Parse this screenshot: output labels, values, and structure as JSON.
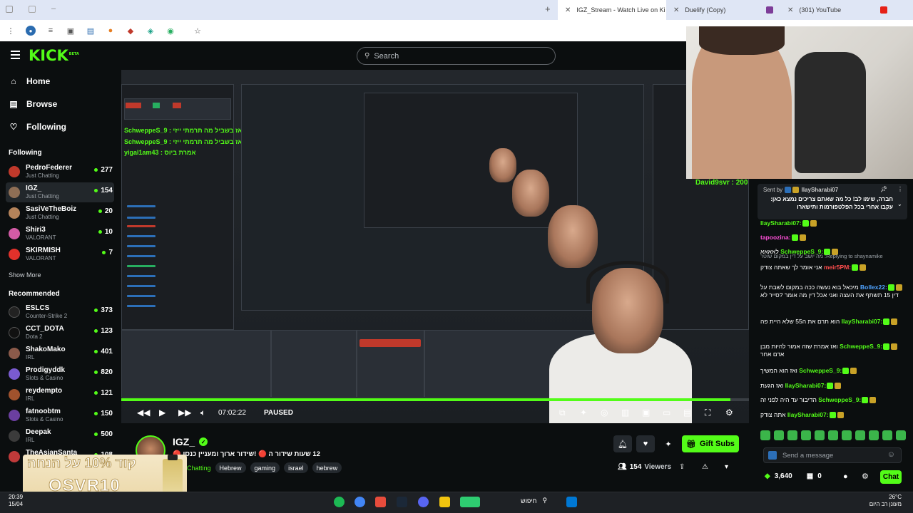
{
  "browser": {
    "tabs": [
      {
        "title": "IGZ_Stream - Watch Live on Ki",
        "active": true
      },
      {
        "title": "Duelify (Copy)",
        "active": false
      },
      {
        "title": "(301) YouTube",
        "active": false
      }
    ]
  },
  "header": {
    "logo": "KICK",
    "logo_sup": "BETA",
    "search_placeholder": "Search"
  },
  "sidebar": {
    "nav": [
      {
        "label": "Home",
        "icon": "home-icon"
      },
      {
        "label": "Browse",
        "icon": "browse-icon"
      },
      {
        "label": "Following",
        "icon": "heart-icon"
      }
    ],
    "following_title": "Following",
    "following": [
      {
        "name": "PedroFederer",
        "category": "Just Chatting",
        "viewers": "277",
        "color": "#c0392b"
      },
      {
        "name": "IGZ_",
        "category": "Just Chatting",
        "viewers": "154",
        "color": "#8e6e55",
        "selected": true
      },
      {
        "name": "SasiVeTheBoiz",
        "category": "Just Chatting",
        "viewers": "20",
        "color": "#b5835a"
      },
      {
        "name": "Shiri3",
        "category": "VALORANT",
        "viewers": "10",
        "color": "#d35ba6"
      },
      {
        "name": "SKIRMISH",
        "category": "VALORANT",
        "viewers": "7",
        "color": "#e0312b"
      }
    ],
    "show_more": "Show More",
    "recommended_title": "Recommended",
    "recommended": [
      {
        "name": "ESLCS",
        "category": "Counter-Strike 2",
        "viewers": "373",
        "color": "#222"
      },
      {
        "name": "CCT_DOTA",
        "category": "Dota 2",
        "viewers": "123",
        "color": "#111"
      },
      {
        "name": "ShakoMako",
        "category": "IRL",
        "viewers": "401",
        "color": "#8b5a4a"
      },
      {
        "name": "Prodigyddk",
        "category": "Slots & Casino",
        "viewers": "820",
        "color": "#7a5bd0"
      },
      {
        "name": "reydempto",
        "category": "IRL",
        "viewers": "121",
        "color": "#a0522d"
      },
      {
        "name": "fatnoobtm",
        "category": "Slots & Casino",
        "viewers": "150",
        "color": "#6b3fa0"
      },
      {
        "name": "Deepak",
        "category": "IRL",
        "viewers": "500",
        "color": "#3b3b3b"
      },
      {
        "name": "TheAsianSanta",
        "category": "",
        "viewers": "108",
        "color": "#c03a3a"
      }
    ]
  },
  "player": {
    "time": "07:02:22",
    "status": "PAUSED",
    "progress": 0.97
  },
  "stream": {
    "owner": "IGZ_",
    "title": "12 שעות שידור ה 🔴 !שידור ארוך ומעניין כנסו 🔴",
    "category": "Chatting",
    "tags": [
      "Hebrew",
      "gaming",
      "israel",
      "hebrew"
    ],
    "viewers": "154",
    "viewers_label": "Viewers",
    "gift_button": "Gift Subs"
  },
  "overlay": {
    "viewer_top": "David9svr : 200",
    "promo_line1": "קוד 10% על הנחה",
    "promo_code": "OSVR10"
  },
  "chat": {
    "pinned_header": "Sent by",
    "pinned_user": "IlaySharabi07",
    "pinned_text": "חברה, שימו לב! כל מה שאתם צריכים נמצא כאן: עקבו אחרי בכל הפלטפורמות ותישארו",
    "messages": [
      {
        "user": "IlaySharabi07:",
        "text": "",
        "color": "#53fc18"
      },
      {
        "user": "tapoozina:",
        "text": "",
        "color": "#ff4fd8"
      },
      {
        "user": "SchweppeS_9:",
        "text": "לאאאא",
        "color": "#53fc18"
      },
      {
        "user": "meir5PM:",
        "text": "אני אומר לך שאתה צודק",
        "color": "#ff4d4d",
        "reply": "Replying to shaynamike: מה יושב על דין במקום שוטר"
      },
      {
        "user": "Bollex22:",
        "text": "מיכאל בוא נעשה ככה במקום לשבת על דין 15 תשתף את העצה ואני אכל דין מה אומר ?סייר לא",
        "color": "#4fa3ff"
      },
      {
        "user": "IlaySharabi07:",
        "text": "הוא תרם את ה55 שלא היית פה",
        "color": "#53fc18"
      },
      {
        "user": "SchweppeS_9:",
        "text": "ואז אמרת שזה אמור להיות מבן אדם אחר",
        "color": "#53fc18"
      },
      {
        "user": "SchweppeS_9:",
        "text": "ואז הוא המשיך",
        "color": "#53fc18"
      },
      {
        "user": "IlaySharabi07:",
        "text": "ואז הגעת",
        "color": "#53fc18"
      },
      {
        "user": "SchweppeS_9:",
        "text": "הדיבור עד היה לפני זה",
        "color": "#53fc18"
      },
      {
        "user": "IlaySharabi07:",
        "text": "אתה צודק",
        "color": "#53fc18"
      }
    ],
    "send_placeholder": "Send a message",
    "points": "3,640",
    "subs": "0",
    "chat_button": "Chat"
  },
  "taskbar": {
    "time": "20:39",
    "date": "15/04",
    "search": "חיפוש",
    "temp": "26°C",
    "weather": "מעונן רב היום"
  }
}
